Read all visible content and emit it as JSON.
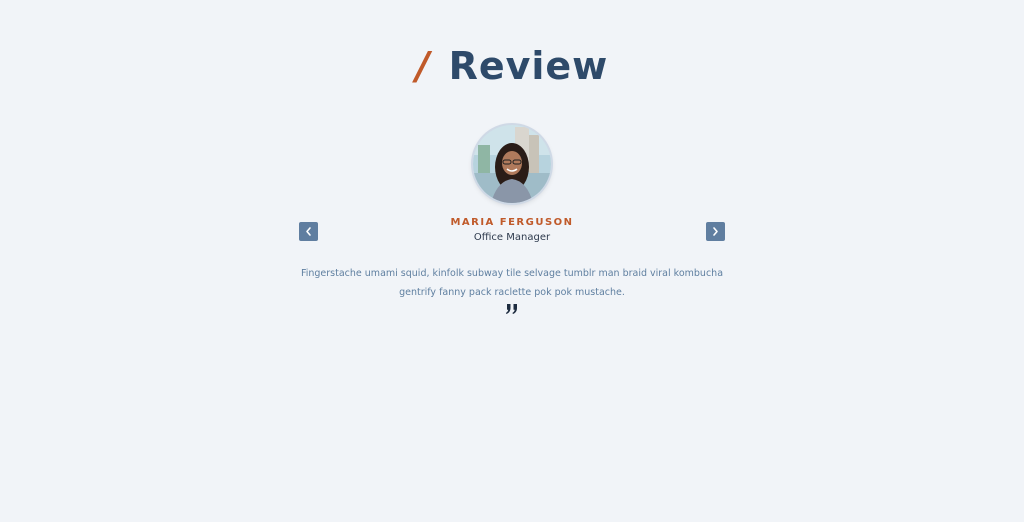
{
  "section": {
    "slash": "/",
    "title": "Review"
  },
  "review": {
    "name": "MARIA FERGUSON",
    "role": "Office Manager",
    "text": "Fingerstache umami squid, kinfolk subway tile selvage tumblr man braid viral kombucha gentrify fanny pack raclette pok pok mustache."
  },
  "icons": {
    "prev": "chevron-left-icon",
    "next": "chevron-right-icon",
    "quote": "quote-right-icon"
  },
  "colors": {
    "background": "#f1f4f8",
    "title": "#2e4a6a",
    "accent": "#c05a2a",
    "button": "#607ea0",
    "body_text": "#5f7fa0"
  }
}
